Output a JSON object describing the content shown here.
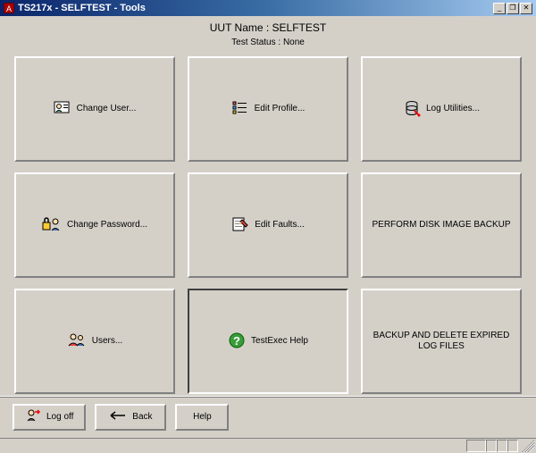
{
  "window": {
    "title": "TS217x - SELFTEST - Tools"
  },
  "header": {
    "uut_label": "UUT Name : SELFTEST",
    "status_label": "Test Status : None"
  },
  "tiles": {
    "change_user": "Change User...",
    "edit_profile": "Edit Profile...",
    "log_utilities": "Log Utilities...",
    "change_password": "Change Password...",
    "edit_faults": "Edit Faults...",
    "disk_image_backup": "PERFORM DISK IMAGE  BACKUP",
    "users": "Users...",
    "testexec_help": "TestExec Help",
    "backup_delete_log": "BACKUP AND DELETE EXPIRED LOG FILES"
  },
  "footer": {
    "logoff": "Log off",
    "back": "Back",
    "help": "Help"
  },
  "statusbar": {
    "cell1": ""
  }
}
